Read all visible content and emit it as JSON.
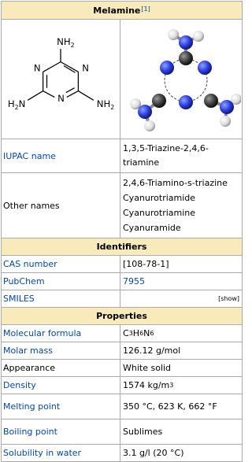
{
  "title": "Melamine",
  "title_ref": "[1]",
  "structure": {
    "nh2_top": "NH",
    "nh2_left": "H",
    "nh2_right": "NH",
    "n_left": "N",
    "n_right": "N",
    "n_bottom": "N",
    "sub_2": "2"
  },
  "rows": {
    "iupac": {
      "label": "IUPAC name",
      "value": "1,3,5-Triazine-2,4,6-triamine"
    },
    "other_names": {
      "label": "Other names",
      "values": [
        "2,4,6-Triamino-s-triazine",
        "Cyanurotriamide",
        "Cyanurotriamine",
        "Cyanuramide"
      ]
    },
    "identifiers_header": "Identifiers",
    "cas": {
      "label": "CAS number",
      "value": "[108-78-1]"
    },
    "pubchem": {
      "label": "PubChem",
      "value": "7955"
    },
    "smiles": {
      "label": "SMILES",
      "show": "[show]"
    },
    "properties_header": "Properties",
    "formula": {
      "label": "Molecular formula",
      "c": "C",
      "c_n": "3",
      "h": "H",
      "h_n": "6",
      "n": "N",
      "n_n": "6"
    },
    "molar_mass": {
      "label": "Molar mass",
      "value": "126.12 g/mol"
    },
    "appearance": {
      "label": "Appearance",
      "value": "White solid"
    },
    "density": {
      "label": "Density",
      "value": "1574 kg/m",
      "exp": "3"
    },
    "melting": {
      "label": "Melting point",
      "value": "350 °C, 623 K, 662 °F"
    },
    "boiling": {
      "label": "Boiling point",
      "value": "Sublimes"
    },
    "solubility": {
      "label": "Solubility in water",
      "value": "3.1 g/l (20 °C)"
    }
  }
}
